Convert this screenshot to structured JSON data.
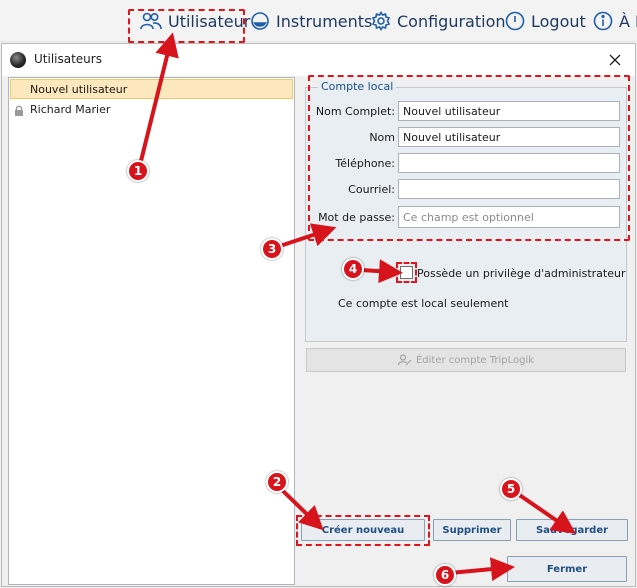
{
  "nav": {
    "items": [
      {
        "label": "Utilisateur",
        "icon": "users-icon"
      },
      {
        "label": "Instruments",
        "icon": "instrument-icon"
      },
      {
        "label": "Configuration",
        "icon": "gear-icon"
      },
      {
        "label": "Logout",
        "icon": "power-icon"
      },
      {
        "label": "À P",
        "icon": "info-icon"
      }
    ]
  },
  "window": {
    "title": "Utilisateurs",
    "close_glyph": "✕"
  },
  "user_list": {
    "items": [
      {
        "label": "Nouvel utilisateur",
        "selected": true,
        "locked": false
      },
      {
        "label": "Richard Marier",
        "selected": false,
        "locked": true
      }
    ]
  },
  "account": {
    "group_title": "Compte local",
    "fields": [
      {
        "label": "Nom Complet:",
        "value": "Nouvel utilisateur",
        "placeholder": ""
      },
      {
        "label": "Nom",
        "value": "Nouvel utilisateur",
        "placeholder": ""
      },
      {
        "label": "Téléphone:",
        "value": "",
        "placeholder": ""
      },
      {
        "label": "Courriel:",
        "value": "",
        "placeholder": ""
      },
      {
        "label": "Mot de passe:",
        "value": "",
        "placeholder": "Ce champ est optionnel"
      }
    ],
    "admin_label": "Possède un privilège d'administrateur",
    "admin_checked": false,
    "local_note": "Ce compte est local seulement",
    "triplogik_label": "Éditer compte TripLogik"
  },
  "buttons": {
    "create": "Créer nouveau",
    "delete": "Supprimer",
    "save": "Sauvegarder",
    "close": "Fermer"
  },
  "callouts": [
    "1",
    "2",
    "3",
    "4",
    "5",
    "6"
  ],
  "colors": {
    "accent": "#1f3a60",
    "callout_red": "#d7141b",
    "selection": "#fde7bd"
  }
}
